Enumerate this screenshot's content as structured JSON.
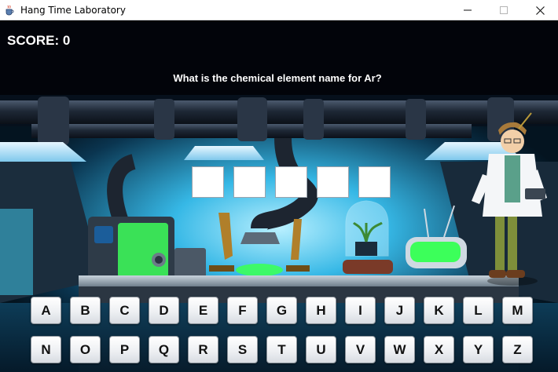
{
  "window": {
    "title": "Hang Time Laboratory",
    "app_icon": "java-cup-icon",
    "controls": [
      "minimize-icon",
      "maximize-icon",
      "close-icon"
    ]
  },
  "game": {
    "score": "SCORE: 0",
    "question": "What is the chemical element name for Ar?",
    "answer_slots": [
      "",
      "",
      "",
      "",
      ""
    ],
    "keyboard": {
      "row1": [
        "A",
        "B",
        "C",
        "D",
        "E",
        "F",
        "G",
        "H",
        "I",
        "J",
        "K",
        "L",
        "M"
      ],
      "row2": [
        "N",
        "O",
        "P",
        "Q",
        "R",
        "S",
        "T",
        "U",
        "V",
        "W",
        "X",
        "Y",
        "Z"
      ]
    }
  },
  "colors": {
    "score_text": "#ffffff",
    "lab_glow": "#1fb6e8",
    "liquid_green": "#3cff5a",
    "key_face": "#f2f3f5"
  }
}
